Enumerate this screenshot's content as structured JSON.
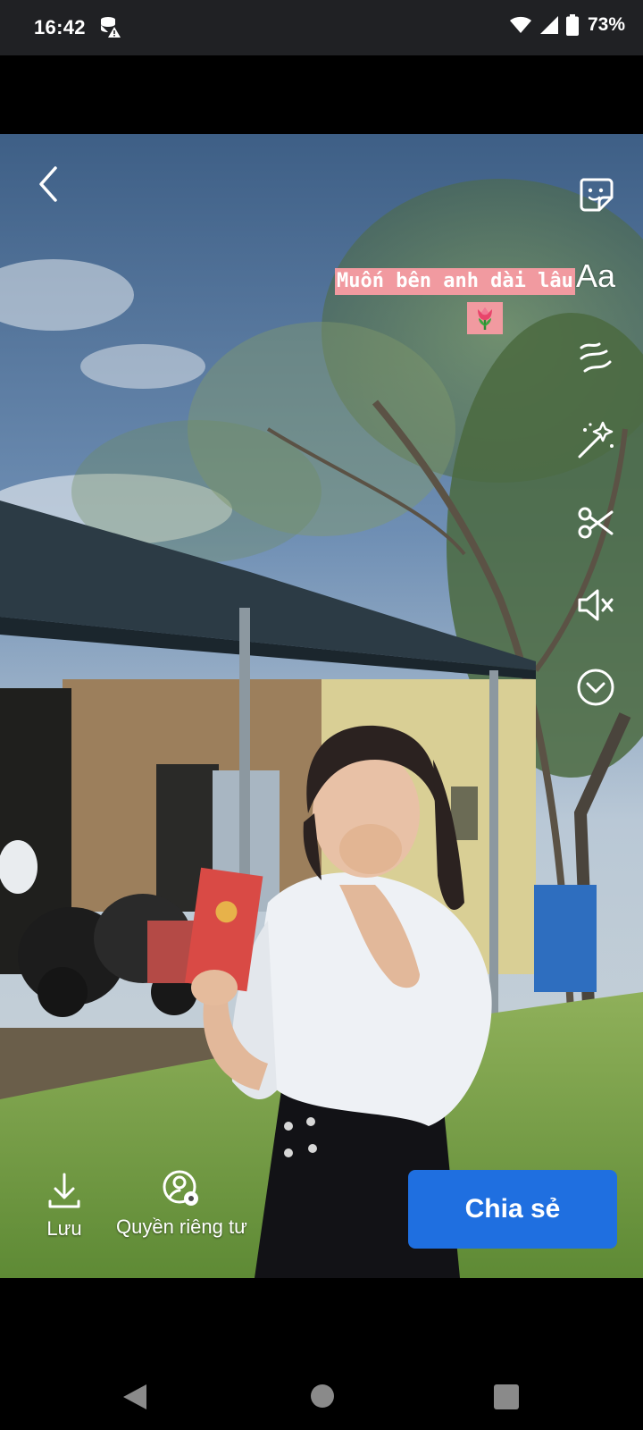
{
  "status_bar": {
    "time": "16:42",
    "battery_percent": "73%",
    "icons": [
      "data-saver-warning-icon",
      "wifi-icon",
      "signal-icon",
      "battery-icon"
    ]
  },
  "editor": {
    "caption_text": "Muốn bên anh dài lâu",
    "caption_emoji": "🌷",
    "caption_bg_color": "#f19aa0",
    "tools": [
      {
        "name": "sticker-icon"
      },
      {
        "name": "text-tool",
        "label": "Aa"
      },
      {
        "name": "effects-squiggle-icon"
      },
      {
        "name": "magic-wand-icon"
      },
      {
        "name": "scissors-icon"
      },
      {
        "name": "sound-off-icon"
      },
      {
        "name": "more-chevron-icon"
      }
    ]
  },
  "actions": {
    "save_label": "Lưu",
    "privacy_label": "Quyền riêng tư",
    "share_label": "Chia sẻ",
    "share_color": "#1f6fe0"
  },
  "nav": {
    "icons": [
      "back-triangle-icon",
      "home-circle-icon",
      "recents-square-icon"
    ]
  }
}
